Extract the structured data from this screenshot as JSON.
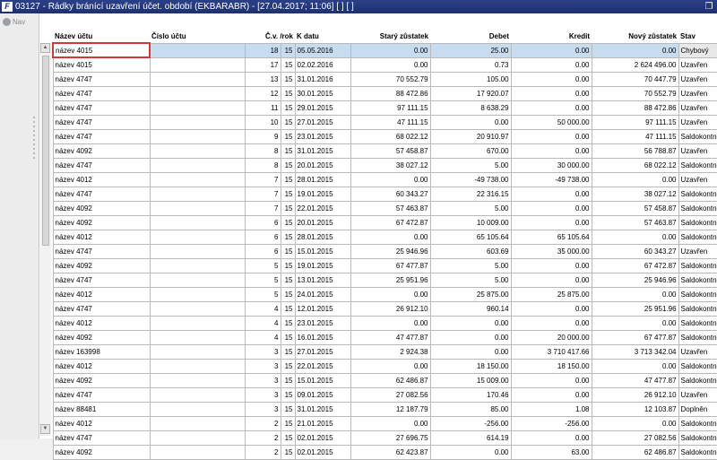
{
  "window": {
    "title": "03127 - Řádky bránící uzavření účet. období (EKBARABR) - [27.04.2017; 11:06] [ ] [ ]",
    "app_icon": "F",
    "restore_icon": "restore-icon"
  },
  "nav": {
    "label": "Nav"
  },
  "table": {
    "columns": [
      "Název účtu",
      "Číslo účtu",
      "Č.v. /rok",
      "K datu",
      "Starý zůstatek",
      "Debet",
      "Kredit",
      "Nový zůstatek",
      "Stav"
    ],
    "rows": [
      {
        "nazev": "název 4015",
        "cislo": "",
        "cv": "18",
        "rok": "15",
        "datum": "05.05.2016",
        "stary": "0.00",
        "debet": "25.00",
        "kredit": "0.00",
        "novy": "0.00",
        "stav": "Chybový"
      },
      {
        "nazev": "název 4015",
        "cislo": "",
        "cv": "17",
        "rok": "15",
        "datum": "02.02.2016",
        "stary": "0.00",
        "debet": "0.73",
        "kredit": "0.00",
        "novy": "2 624 496.00",
        "stav": "Uzavřen"
      },
      {
        "nazev": "název 4747",
        "cislo": "",
        "cv": "13",
        "rok": "15",
        "datum": "31.01.2016",
        "stary": "70 552.79",
        "debet": "105.00",
        "kredit": "0.00",
        "novy": "70 447.79",
        "stav": "Uzavřen"
      },
      {
        "nazev": "název 4747",
        "cislo": "",
        "cv": "12",
        "rok": "15",
        "datum": "30.01.2015",
        "stary": "88 472.86",
        "debet": "17 920.07",
        "kredit": "0.00",
        "novy": "70 552.79",
        "stav": "Uzavřen"
      },
      {
        "nazev": "název 4747",
        "cislo": "",
        "cv": "11",
        "rok": "15",
        "datum": "29.01.2015",
        "stary": "97 111.15",
        "debet": "8 638.29",
        "kredit": "0.00",
        "novy": "88 472.86",
        "stav": "Uzavřen"
      },
      {
        "nazev": "název 4747",
        "cislo": "",
        "cv": "10",
        "rok": "15",
        "datum": "27.01.2015",
        "stary": "47 111.15",
        "debet": "0.00",
        "kredit": "50 000.00",
        "novy": "97 111.15",
        "stav": "Uzavřen"
      },
      {
        "nazev": "název 4747",
        "cislo": "",
        "cv": "9",
        "rok": "15",
        "datum": "23.01.2015",
        "stary": "68 022.12",
        "debet": "20 910.97",
        "kredit": "0.00",
        "novy": "47 111.15",
        "stav": "Saldokontně vy"
      },
      {
        "nazev": "název 4092",
        "cislo": "",
        "cv": "8",
        "rok": "15",
        "datum": "31.01.2015",
        "stary": "57 458.87",
        "debet": "670.00",
        "kredit": "0.00",
        "novy": "56 788.87",
        "stav": "Uzavřen"
      },
      {
        "nazev": "název 4747",
        "cislo": "",
        "cv": "8",
        "rok": "15",
        "datum": "20.01.2015",
        "stary": "38 027.12",
        "debet": "5.00",
        "kredit": "30 000.00",
        "novy": "68 022.12",
        "stav": "Saldokontně vy"
      },
      {
        "nazev": "název 4012",
        "cislo": "",
        "cv": "7",
        "rok": "15",
        "datum": "28.01.2015",
        "stary": "0.00",
        "debet": "-49 738.00",
        "kredit": "-49 738.00",
        "novy": "0.00",
        "stav": "Uzavřen"
      },
      {
        "nazev": "název 4747",
        "cislo": "",
        "cv": "7",
        "rok": "15",
        "datum": "19.01.2015",
        "stary": "60 343.27",
        "debet": "22 316.15",
        "kredit": "0.00",
        "novy": "38 027.12",
        "stav": "Saldokontně vy"
      },
      {
        "nazev": "název 4092",
        "cislo": "",
        "cv": "7",
        "rok": "15",
        "datum": "22.01.2015",
        "stary": "57 463.87",
        "debet": "5.00",
        "kredit": "0.00",
        "novy": "57 458.87",
        "stav": "Saldokontně vy"
      },
      {
        "nazev": "název 4092",
        "cislo": "",
        "cv": "6",
        "rok": "15",
        "datum": "20.01.2015",
        "stary": "67 472.87",
        "debet": "10 009.00",
        "kredit": "0.00",
        "novy": "57 463.87",
        "stav": "Saldokontně vy"
      },
      {
        "nazev": "název 4012",
        "cislo": "",
        "cv": "6",
        "rok": "15",
        "datum": "28.01.2015",
        "stary": "0.00",
        "debet": "65 105.64",
        "kredit": "65 105.64",
        "novy": "0.00",
        "stav": "Saldokontně vy"
      },
      {
        "nazev": "název 4747",
        "cislo": "",
        "cv": "6",
        "rok": "15",
        "datum": "15.01.2015",
        "stary": "25 946.96",
        "debet": "603.69",
        "kredit": "35 000.00",
        "novy": "60 343.27",
        "stav": "Uzavřen"
      },
      {
        "nazev": "název 4092",
        "cislo": "",
        "cv": "5",
        "rok": "15",
        "datum": "19.01.2015",
        "stary": "67 477.87",
        "debet": "5.00",
        "kredit": "0.00",
        "novy": "67 472.87",
        "stav": "Saldokontně vy"
      },
      {
        "nazev": "název 4747",
        "cislo": "",
        "cv": "5",
        "rok": "15",
        "datum": "13.01.2015",
        "stary": "25 951.96",
        "debet": "5.00",
        "kredit": "0.00",
        "novy": "25 946.96",
        "stav": "Saldokontně vy"
      },
      {
        "nazev": "název 4012",
        "cislo": "",
        "cv": "5",
        "rok": "15",
        "datum": "24.01.2015",
        "stary": "0.00",
        "debet": "25 875.00",
        "kredit": "25 875.00",
        "novy": "0.00",
        "stav": "Saldokontně vy"
      },
      {
        "nazev": "název 4747",
        "cislo": "",
        "cv": "4",
        "rok": "15",
        "datum": "12.01.2015",
        "stary": "26 912.10",
        "debet": "960.14",
        "kredit": "0.00",
        "novy": "25 951.96",
        "stav": "Saldokontně vy"
      },
      {
        "nazev": "název 4012",
        "cislo": "",
        "cv": "4",
        "rok": "15",
        "datum": "23.01.2015",
        "stary": "0.00",
        "debet": "0.00",
        "kredit": "0.00",
        "novy": "0.00",
        "stav": "Saldokontně vy"
      },
      {
        "nazev": "název 4092",
        "cislo": "",
        "cv": "4",
        "rok": "15",
        "datum": "16.01.2015",
        "stary": "47 477.87",
        "debet": "0.00",
        "kredit": "20 000.00",
        "novy": "67 477.87",
        "stav": "Saldokontně vy"
      },
      {
        "nazev": "název 163998",
        "cislo": "",
        "cv": "3",
        "rok": "15",
        "datum": "27.01.2015",
        "stary": "2 924.38",
        "debet": "0.00",
        "kredit": "3 710 417.66",
        "novy": "3 713 342.04",
        "stav": "Uzavřen"
      },
      {
        "nazev": "název 4012",
        "cislo": "",
        "cv": "3",
        "rok": "15",
        "datum": "22.01.2015",
        "stary": "0.00",
        "debet": "18 150.00",
        "kredit": "18 150.00",
        "novy": "0.00",
        "stav": "Saldokontně vy"
      },
      {
        "nazev": "název 4092",
        "cislo": "",
        "cv": "3",
        "rok": "15",
        "datum": "15.01.2015",
        "stary": "62 486.87",
        "debet": "15 009.00",
        "kredit": "0.00",
        "novy": "47 477.87",
        "stav": "Saldokontně vy"
      },
      {
        "nazev": "název 4747",
        "cislo": "",
        "cv": "3",
        "rok": "15",
        "datum": "09.01.2015",
        "stary": "27 082.56",
        "debet": "170.46",
        "kredit": "0.00",
        "novy": "26 912.10",
        "stav": "Uzavřen"
      },
      {
        "nazev": "název 88481",
        "cislo": "",
        "cv": "3",
        "rok": "15",
        "datum": "31.01.2015",
        "stary": "12 187.79",
        "debet": "85.00",
        "kredit": "1.08",
        "novy": "12 103.87",
        "stav": "Doplněn"
      },
      {
        "nazev": "název 4012",
        "cislo": "",
        "cv": "2",
        "rok": "15",
        "datum": "21.01.2015",
        "stary": "0.00",
        "debet": "-256.00",
        "kredit": "-256.00",
        "novy": "0.00",
        "stav": "Saldokontně vy"
      },
      {
        "nazev": "název 4747",
        "cislo": "",
        "cv": "2",
        "rok": "15",
        "datum": "02.01.2015",
        "stary": "27 696.75",
        "debet": "614.19",
        "kredit": "0.00",
        "novy": "27 082.56",
        "stav": "Saldokontně vy"
      },
      {
        "nazev": "název 4092",
        "cislo": "",
        "cv": "2",
        "rok": "15",
        "datum": "02.01.2015",
        "stary": "62 423.87",
        "debet": "0.00",
        "kredit": "63.00",
        "novy": "62 486.87",
        "stav": "Saldokontně vy"
      }
    ]
  },
  "colors": {
    "titlebar": "#1e3270",
    "selected_row": "#c8dcf0",
    "focus_border": "#d23a3a"
  }
}
